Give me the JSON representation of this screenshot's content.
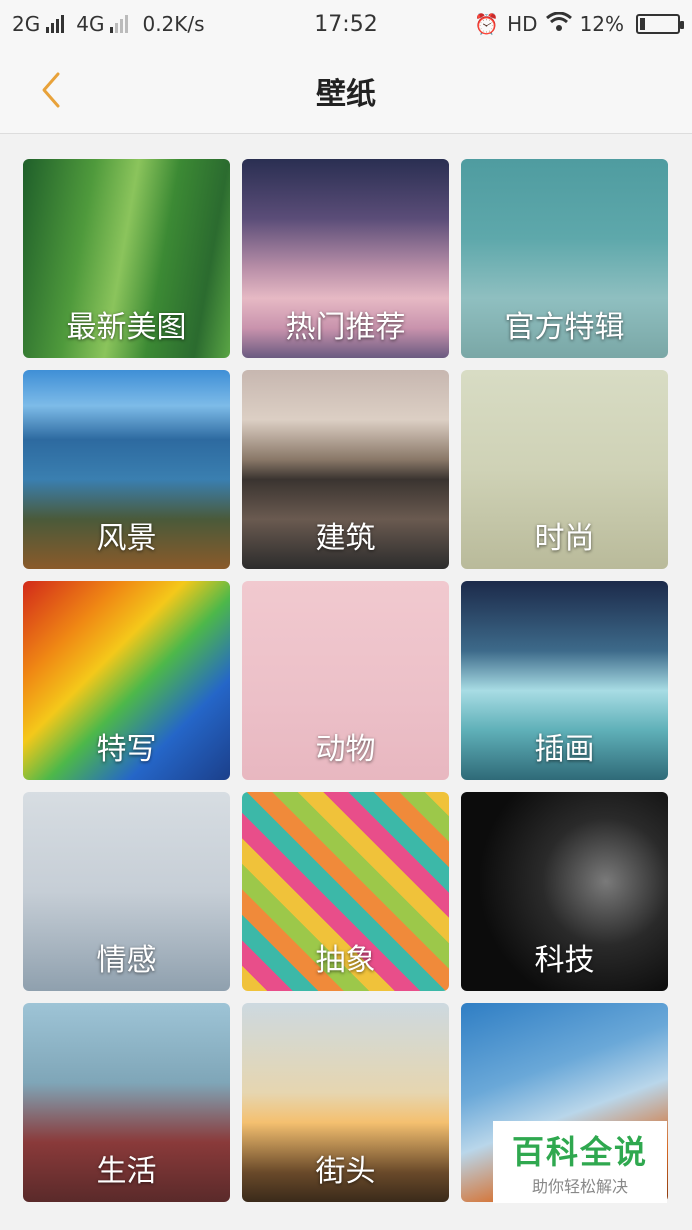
{
  "status_bar": {
    "net1": "2G",
    "net2": "4G",
    "speed": "0.2K/s",
    "time": "17:52",
    "hd": "HD",
    "battery": "12%",
    "battery_level": 0.12,
    "icons": [
      "alarm-icon",
      "wifi-icon",
      "battery-icon"
    ]
  },
  "header": {
    "title": "壁纸",
    "back_icon": "chevron-left-icon",
    "accent": "#e8a23a"
  },
  "categories": [
    {
      "label": "最新美图",
      "bg": "linear-gradient(100deg,#1f5f2a 0%,#4f9a3c 30%,#8bc45c 48%,#3c8a34 65%,#2b6b2f 85%,#5aa545 100%)"
    },
    {
      "label": "热门推荐",
      "bg": "linear-gradient(180deg,#2a2f52 0%,#5b4d78 30%,#b98fa8 55%,#e6b9c4 70%,#c993ad 85%,#6a5a80 100%)"
    },
    {
      "label": "官方特辑",
      "bg": "linear-gradient(180deg,#4f9ca0 0%,#5ea8ab 40%,#8fbfc0 70%,#7aa7a6 100%)"
    },
    {
      "label": "风景",
      "bg": "linear-gradient(180deg,#3f8fd6 0%,#7dbbe8 18%,#2d6aa0 35%,#3a7fb0 55%,#4a5a3a 75%,#8a5a2a 100%)"
    },
    {
      "label": "建筑",
      "bg": "linear-gradient(180deg,#c7b7b0 0%,#dccfc4 25%,#8a7868 45%,#3a3430 55%,#6a5a50 75%,#2c2c2c 100%)"
    },
    {
      "label": "时尚",
      "bg": "linear-gradient(180deg,#d8dcc4 0%,#cfd2b6 50%,#b9ba9a 100%)"
    },
    {
      "label": "特写",
      "bg": "linear-gradient(135deg,#d22a1a 0%,#f08a14 25%,#f4c81a 40%,#4db84a 55%,#2566c8 75%,#1b3f8a 100%)"
    },
    {
      "label": "动物",
      "bg": "linear-gradient(180deg,#f1c9cf 0%,#ecc0c8 60%,#e8b7c0 100%)"
    },
    {
      "label": "插画",
      "bg": "linear-gradient(180deg,#1c2a4a 0%,#3d6a8a 35%,#a8dce4 55%,#5fb0b8 75%,#2f6a78 100%)"
    },
    {
      "label": "情感",
      "bg": "linear-gradient(180deg,#d7dde2 0%,#c6ced6 50%,#8fa0ae 100%)"
    },
    {
      "label": "抽象",
      "bg": "repeating-linear-gradient(45deg,#f0c23a 0 18px,#e84e8a 18px 36px,#3cb8a8 36px 54px,#f08a3a 54px 72px,#9cc84a 72px 90px)"
    },
    {
      "label": "科技",
      "bg": "radial-gradient(circle at 70% 45%,#7a7a7a 0%,#2a2a2a 35%,#0c0c0c 70%)"
    },
    {
      "label": "生活",
      "bg": "linear-gradient(180deg,#9ec4d6 0%,#7fa6b8 40%,#8a3a3a 70%,#5a2a2a 100%)"
    },
    {
      "label": "街头",
      "bg": "linear-gradient(180deg,#cdd9e0 0%,#e6d6b0 45%,#f4c070 60%,#6a4a2a 85%,#3a2a1a 100%)"
    },
    {
      "label": "",
      "bg": "linear-gradient(160deg,#2f7ec4 0%,#6aa8d8 35%,#b9d6ea 55%,#d86a24 80%,#8a3a10 100%)"
    }
  ],
  "watermark": {
    "brand": "百科全说",
    "slogan": "助你轻松解决"
  }
}
